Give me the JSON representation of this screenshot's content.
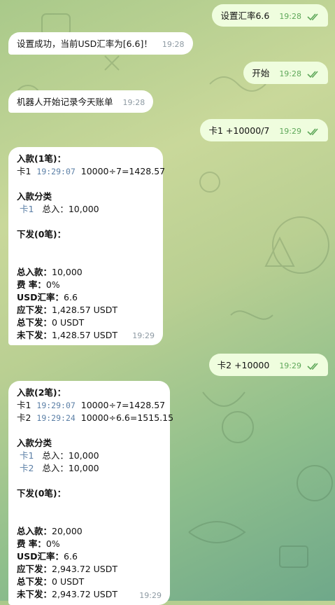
{
  "colors": {
    "outgoing_bubble": "#effdde",
    "incoming_bubble": "#ffffff",
    "time_outgoing": "#5fa85a",
    "time_incoming": "#8e9aa3",
    "link": "#5b7fa6"
  },
  "messages": [
    {
      "text": "设置汇率6.6",
      "time": "19:28"
    },
    {
      "text": "设置成功，当前USD汇率为[6.6]！",
      "time": "19:28"
    },
    {
      "text": "开始",
      "time": "19:28"
    },
    {
      "text": "机器人开始记录今天账单",
      "time": "19:28"
    },
    {
      "text": "卡1 +10000/7",
      "time": "19:29"
    },
    {
      "text": "卡2 +10000",
      "time": "19:29"
    }
  ],
  "bill1": {
    "deposit_title": "入款(1笔)：",
    "rows": [
      {
        "card": "卡1",
        "time": "19:29:07",
        "calc": "10000÷7=1428.57"
      }
    ],
    "category_title": "入款分类",
    "categories": [
      {
        "card": "卡1",
        "total": "总入：10,000"
      }
    ],
    "payout_title": "下发(0笔)：",
    "summary": {
      "total_in_label": "总入款：",
      "total_in": "10,000",
      "fee_label": "费  率：",
      "fee": "0%",
      "rate_label": "USD汇率：",
      "rate": "6.6",
      "due_label": "应下发：",
      "due": "1,428.57 USDT",
      "paid_label": "总下发：",
      "paid": "0 USDT",
      "unpaid_label": "未下发：",
      "unpaid": "1,428.57 USDT"
    },
    "time": "19:29"
  },
  "bill2": {
    "deposit_title": "入款(2笔)：",
    "rows": [
      {
        "card": "卡1",
        "time": "19:29:07",
        "calc": "10000÷7=1428.57"
      },
      {
        "card": "卡2",
        "time": "19:29:24",
        "calc": "10000÷6.6=1515.15"
      }
    ],
    "category_title": "入款分类",
    "categories": [
      {
        "card": "卡1",
        "total": "总入：10,000"
      },
      {
        "card": "卡2",
        "total": "总入：10,000"
      }
    ],
    "payout_title": "下发(0笔)：",
    "summary": {
      "total_in_label": "总入款：",
      "total_in": "20,000",
      "fee_label": "费  率：",
      "fee": "0%",
      "rate_label": "USD汇率：",
      "rate": "6.6",
      "due_label": "应下发：",
      "due": "2,943.72 USDT",
      "paid_label": "总下发：",
      "paid": "0 USDT",
      "unpaid_label": "未下发：",
      "unpaid": "2,943.72 USDT"
    },
    "time": "19:29"
  }
}
